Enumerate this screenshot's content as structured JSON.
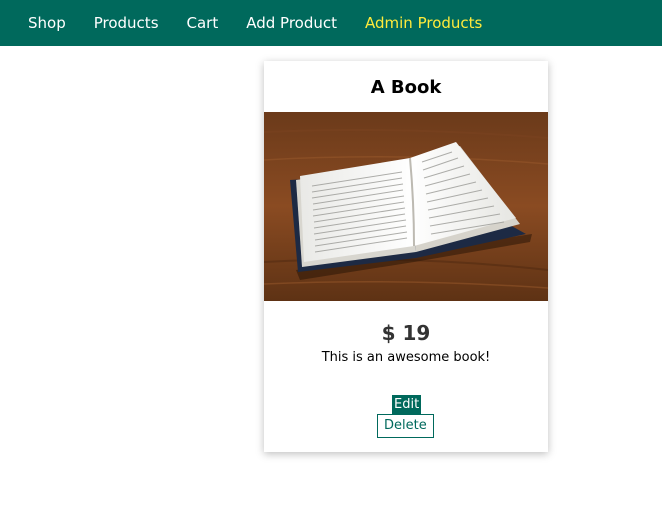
{
  "nav": {
    "items": [
      {
        "label": "Shop",
        "active": false
      },
      {
        "label": "Products",
        "active": false
      },
      {
        "label": "Cart",
        "active": false
      },
      {
        "label": "Add Product",
        "active": false
      },
      {
        "label": "Admin Products",
        "active": true
      }
    ]
  },
  "product": {
    "title": "A Book",
    "price": "$ 19",
    "description": "This is an awesome book!",
    "image": "open-book-photo",
    "edit_label": "Edit",
    "delete_label": "Delete"
  },
  "colors": {
    "header_bg": "#00695c",
    "nav_text": "#ffffff",
    "nav_active": "#ffeb3b",
    "accent": "#00695c"
  }
}
